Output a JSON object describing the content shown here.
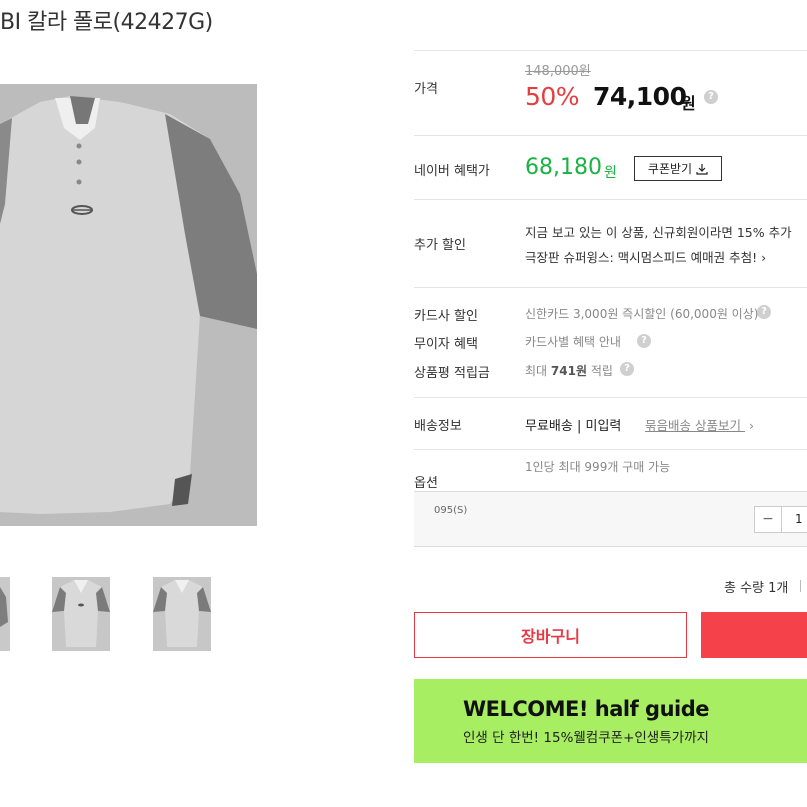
{
  "product": {
    "title": "BI 칼라 폴로(42427G)"
  },
  "gallery": {
    "main_image": "polo-shirt-grey",
    "thumbnails": [
      "polo-shirt-grey",
      "polo-shirt-grey-front",
      "polo-shirt-grey-back"
    ]
  },
  "price": {
    "label": "가격",
    "original": "148,000원",
    "discount": "50%",
    "sale": "74,100",
    "unit": "원"
  },
  "naver": {
    "label": "네이버 혜택가",
    "price": "68,180",
    "unit": "원",
    "coupon_button": "쿠폰받기",
    "coupon_icon": "download-icon"
  },
  "extra_discount": {
    "label": "추가 할인",
    "line1": "지금 보고 있는 이 상품, 신규회원이라면 15% 추가",
    "line2": "극장판 슈퍼윙스: 맥시멈스피드 예매권 추첨!",
    "arrow": "›"
  },
  "benefits": [
    {
      "label": "카드사 할인",
      "value": "신한카드 3,000원 즉시할인 (60,000원 이상)"
    },
    {
      "label": "무이자 혜택",
      "value": "카드사별 혜택 안내"
    },
    {
      "label": "상품평 적립금",
      "value_prefix": "최대 ",
      "value_bold": "741원",
      "value_suffix": " 적립"
    }
  ],
  "shipping": {
    "label": "배송정보",
    "value": "무료배송 | 미입력",
    "link": "묶음배송 상품보기",
    "arrow": "›"
  },
  "option": {
    "label": "옵션",
    "limit": "1인당 최대 999개 구매 가능",
    "selected": "095(S)",
    "minus": "−",
    "quantity": "1"
  },
  "total": {
    "text": "총 수량 1개"
  },
  "actions": {
    "cart": "장바구니"
  },
  "banner": {
    "headline": "WELCOME! half guide",
    "subline": "인생 단 한번! 15%웰컴쿠폰+인생특가까지"
  },
  "colors": {
    "sale_red": "#e53e3e",
    "naver_green": "#19b243",
    "cart_red": "#e83a44",
    "banner_green": "#a8ee63"
  }
}
